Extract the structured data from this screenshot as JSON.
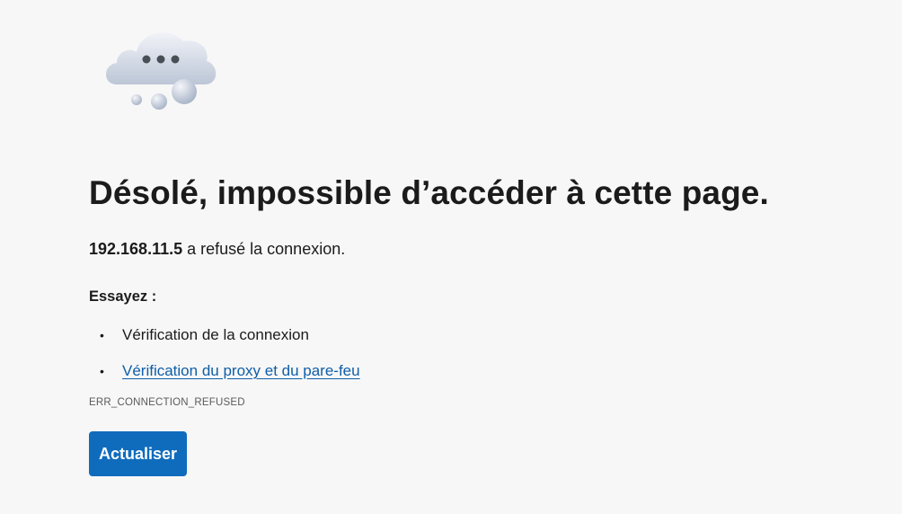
{
  "error_page": {
    "illustration_icon": "cloud-with-ellipsis-icon",
    "title": "Désolé, impossible d’accéder à cette page.",
    "subtitle_host": "192.168.11.5",
    "subtitle_rest": " a refusé la connexion.",
    "try_heading": "Essayez :",
    "bullet": "•",
    "suggestions": [
      {
        "label": "Vérification de la connexion",
        "is_link": false
      },
      {
        "label": "Vérification du proxy et du pare-feu",
        "is_link": true
      }
    ],
    "error_code": "ERR_CONNECTION_REFUSED",
    "refresh_button_label": "Actualiser"
  },
  "colors": {
    "background": "#f7f7f7",
    "text": "#1b1b1b",
    "link": "#0f5ea8",
    "button": "#0f6cbd",
    "button_text": "#ffffff",
    "muted": "#5a5a5a"
  }
}
